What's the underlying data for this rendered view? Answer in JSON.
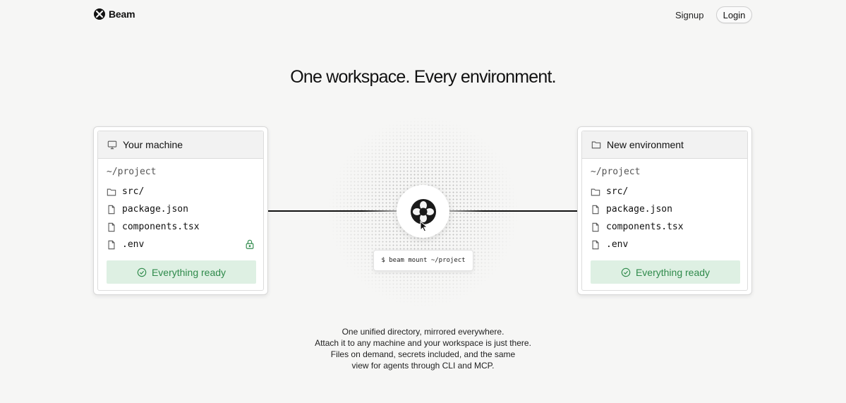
{
  "nav": {
    "brand": "Beam",
    "signup": "Signup",
    "login": "Login"
  },
  "hero": {
    "headline": "One workspace. Every environment."
  },
  "left_panel": {
    "title": "Your machine",
    "path": "~/project",
    "files": [
      {
        "name": "src/",
        "icon": "folder-icon"
      },
      {
        "name": "package.json",
        "icon": "file-icon"
      },
      {
        "name": "components.tsx",
        "icon": "file-icon"
      },
      {
        "name": ".env",
        "icon": "file-icon"
      }
    ],
    "status": "Everything ready"
  },
  "right_panel": {
    "title": "New environment",
    "path": "~/project",
    "files": [
      {
        "name": "src/",
        "icon": "folder-icon"
      },
      {
        "name": "package.json",
        "icon": "file-icon"
      },
      {
        "name": "components.tsx",
        "icon": "file-icon"
      },
      {
        "name": ".env",
        "icon": "file-icon"
      }
    ],
    "status": "Everything ready"
  },
  "center": {
    "command": "$ beam mount ~/project"
  },
  "description": {
    "lines": [
      "One unified directory, mirrored everywhere.",
      "Attach it to any machine and your workspace is just there.",
      "Files on demand, secrets included, and the same",
      "view for agents through CLI and MCP."
    ]
  },
  "colors": {
    "background": "#f6f6f5",
    "success_bg": "#def0e3",
    "success_text": "#2f8a4b"
  }
}
